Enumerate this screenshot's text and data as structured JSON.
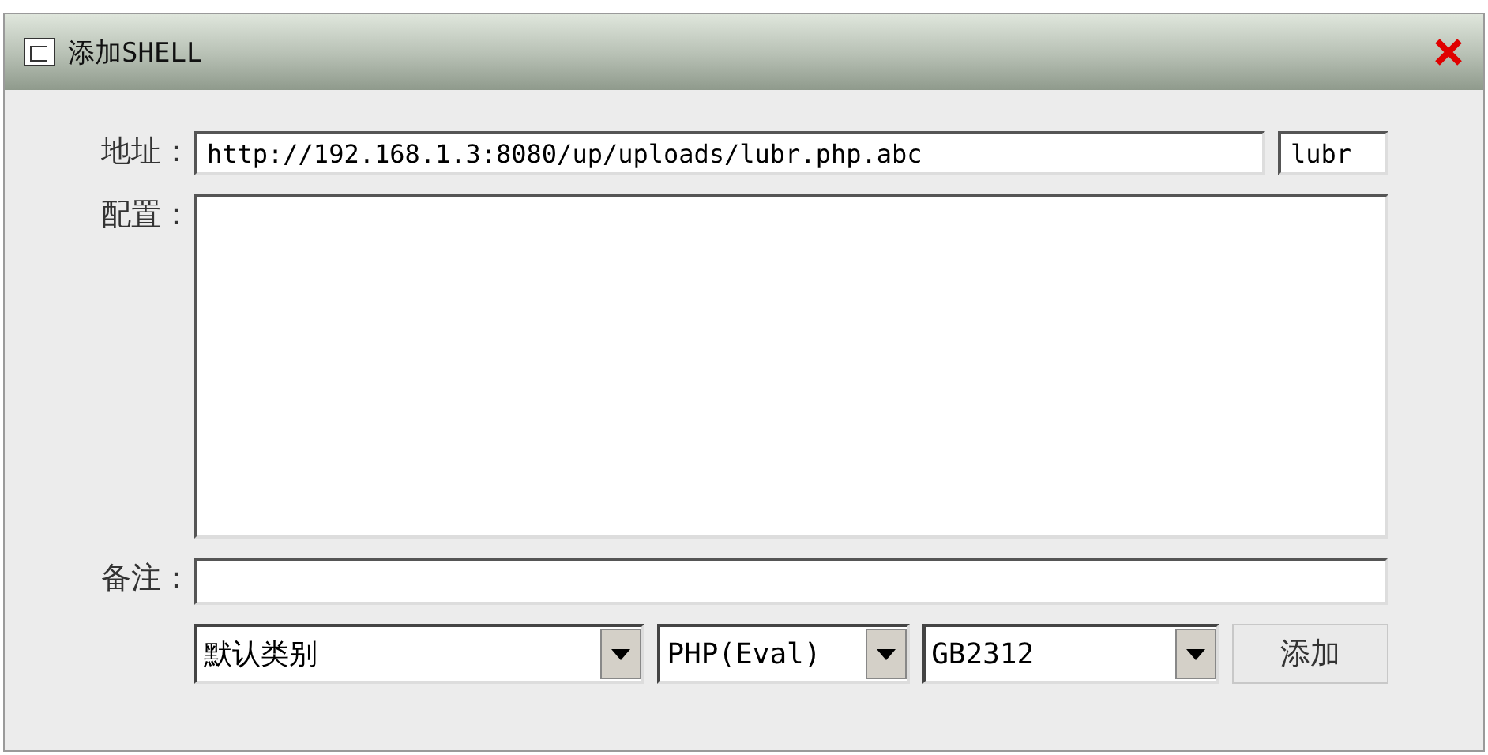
{
  "window": {
    "title": "添加SHELL"
  },
  "address": {
    "label": "地址：",
    "value": "http://192.168.1.3:8080/up/uploads/lubr.php.abc",
    "password": "lubr"
  },
  "config": {
    "label": "配置："
  },
  "note": {
    "label": "备注："
  },
  "dropdowns": [
    {
      "value": "默认类别"
    },
    {
      "value": "PHP(Eval)"
    },
    {
      "value": "GB2312"
    }
  ],
  "buttons": [
    {
      "label": "添加"
    }
  ]
}
